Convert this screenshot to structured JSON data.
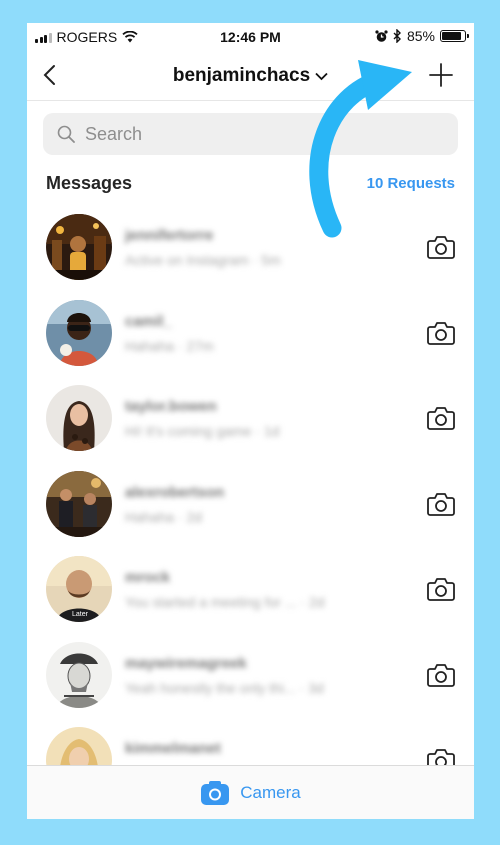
{
  "status_bar": {
    "carrier": "ROGERS",
    "time": "12:46 PM",
    "battery": "85%",
    "battery_level": 0.85
  },
  "header": {
    "username": "benjaminchacs"
  },
  "search": {
    "placeholder": "Search"
  },
  "messages": {
    "title": "Messages",
    "requests": "10 Requests"
  },
  "conversations": [
    {
      "name": "jennifertorre",
      "preview": "Active on Instagram · 5m",
      "avatar": "night-street"
    },
    {
      "name": "camil_",
      "preview": "Hahaha · 27m",
      "avatar": "sunglasses-portrait"
    },
    {
      "name": "taylor.bowen",
      "preview": "Hi! It's coming game · 1d",
      "avatar": "long-hair-portrait"
    },
    {
      "name": "alexrobertson",
      "preview": "Hahaha · 2d",
      "avatar": "group-outdoor"
    },
    {
      "name": "mrock",
      "preview": "You started a meeting for ... · 2d",
      "avatar": "bald-man-later-shirt"
    },
    {
      "name": "maywiremagreek",
      "preview": "Yeah honestly the only thi... · 3d",
      "avatar": "engraving-portrait"
    },
    {
      "name": "kimmelmanet",
      "preview": "",
      "avatar": "blonde-portrait"
    }
  ],
  "bottom_bar": {
    "label": "Camera"
  },
  "colors": {
    "background": "#8fdcfb",
    "accent_blue": "#3897f0",
    "arrow": "#29b6f6"
  }
}
